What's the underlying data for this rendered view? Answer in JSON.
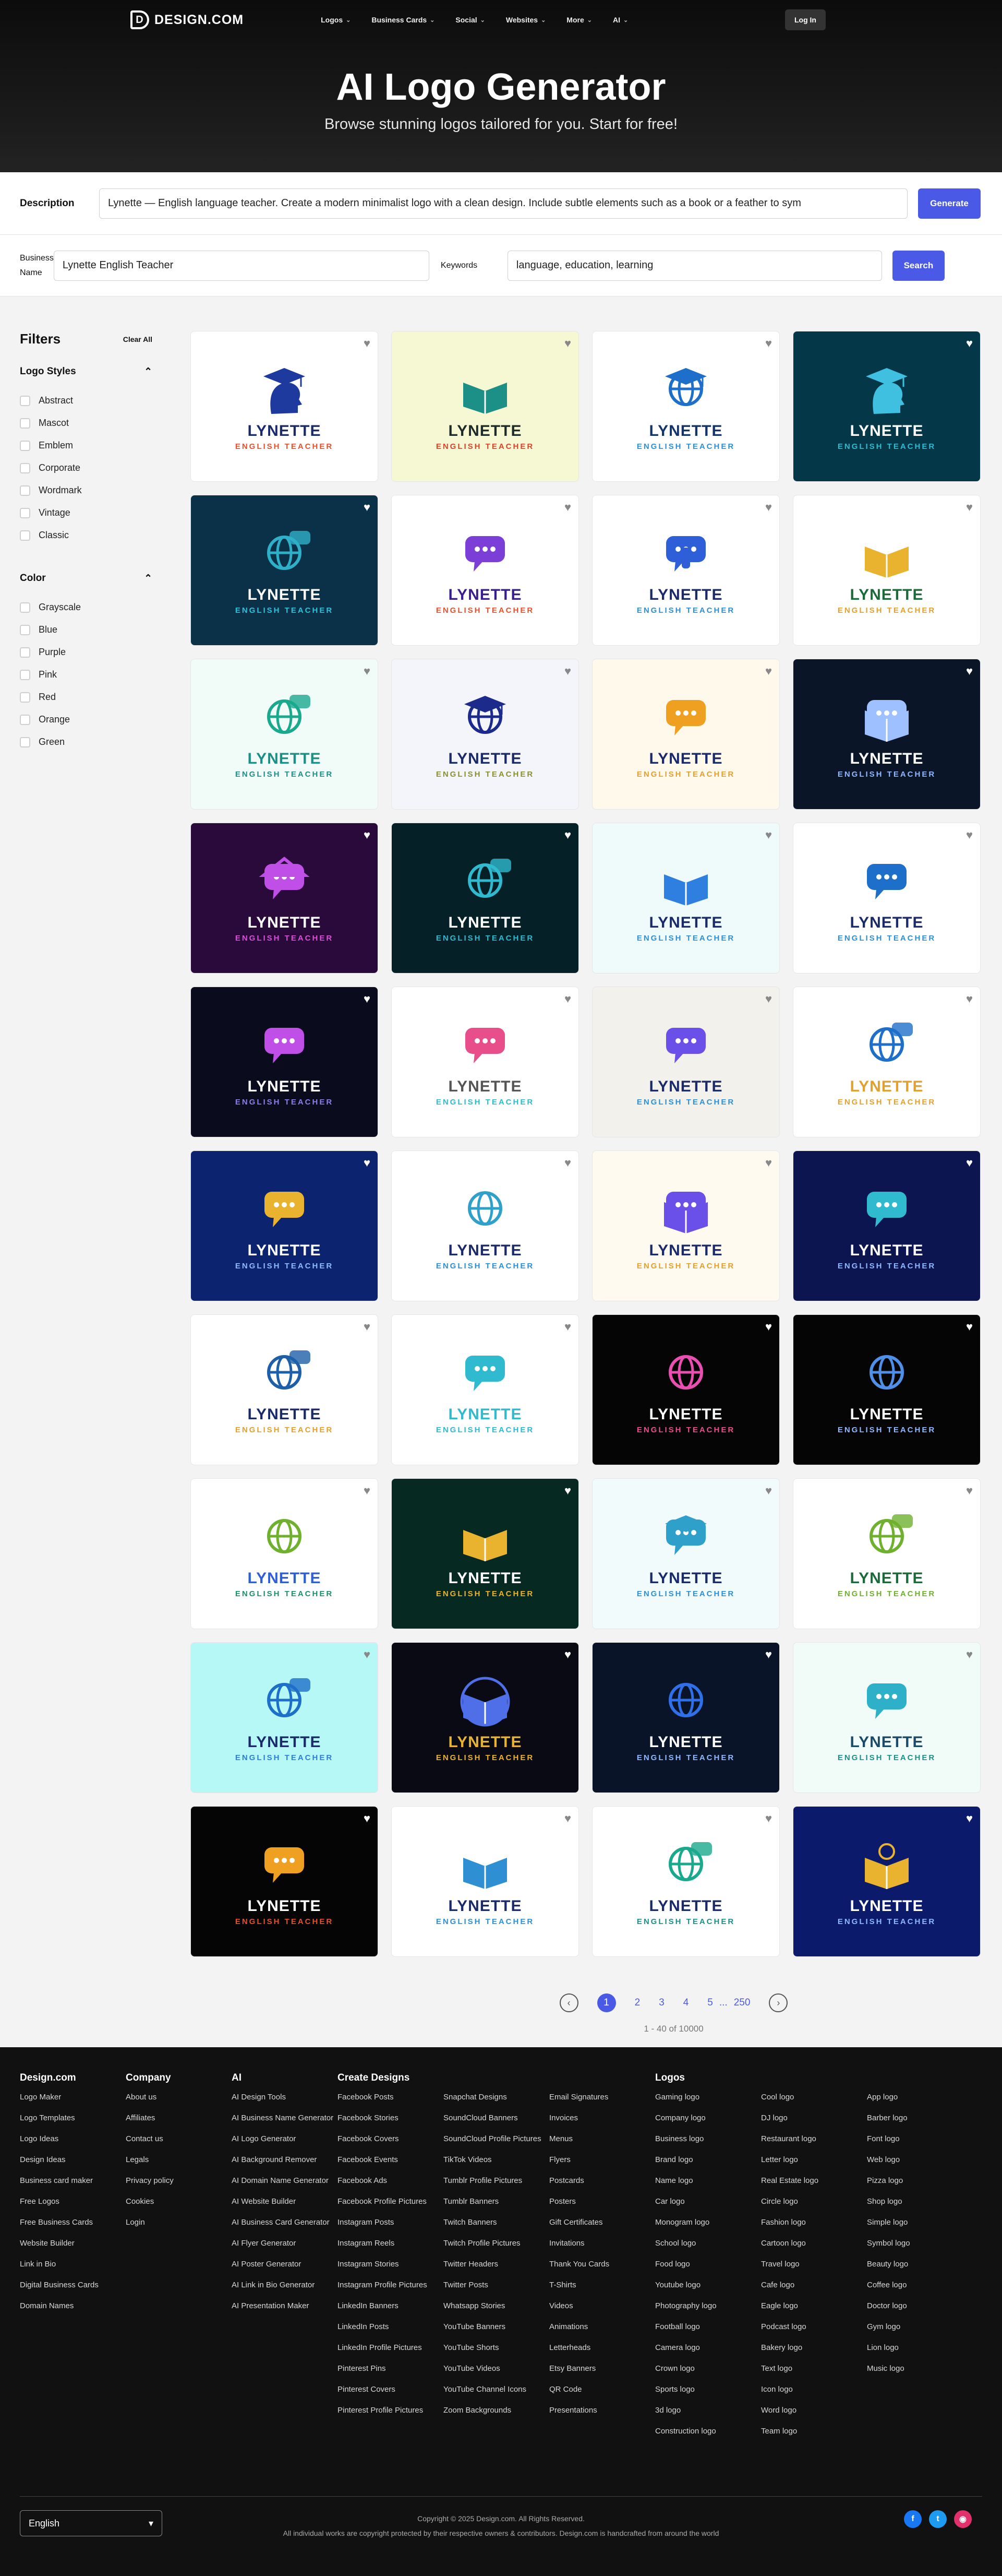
{
  "nav": {
    "brand": "DESIGN.COM",
    "items": [
      "Logos",
      "Business Cards",
      "Social",
      "Websites",
      "More",
      "AI"
    ],
    "login": "Log In"
  },
  "hero": {
    "title": "AI Logo Generator",
    "subtitle": "Browse stunning logos tailored for you. Start for free!"
  },
  "search": {
    "description_label": "Description",
    "description_value": "Lynette — English language teacher. Create a modern minimalist logo with a clean design. Include subtle elements such as a book or a feather to sym",
    "generate": "Generate",
    "business_label_1": "Business",
    "business_label_2": "Name",
    "business_value": "Lynette English Teacher",
    "keywords_label": "Keywords",
    "keywords_value": "language, education, learning",
    "search_btn": "Search"
  },
  "filters": {
    "title": "Filters",
    "clear": "Clear All",
    "styles_title": "Logo Styles",
    "styles": [
      "Abstract",
      "Mascot",
      "Emblem",
      "Corporate",
      "Wordmark",
      "Vintage",
      "Classic"
    ],
    "color_title": "Color",
    "colors": [
      "Grayscale",
      "Blue",
      "Purple",
      "Pink",
      "Red",
      "Orange",
      "Green"
    ]
  },
  "cards": [
    {
      "name": "LYNETTE",
      "sub": "ENGLISH TEACHER",
      "bg": "#ffffff",
      "nc": "#1b2a6b",
      "sc": "#e2522f",
      "icon": "grad-cap-head-icon",
      "ic": "#1e3a9e"
    },
    {
      "name": "LYNETTE",
      "sub": "ENGLISH TEACHER",
      "bg": "#f6f7d3",
      "nc": "#1d2b2b",
      "sc": "#d9442b",
      "icon": "book-speech-icon",
      "ic": "#1c8f86"
    },
    {
      "name": "LYNETTE",
      "sub": "ENGLISH TEACHER",
      "bg": "#ffffff",
      "nc": "#13336b",
      "sc": "#2f8fd3",
      "icon": "globe-cap-icon",
      "ic": "#1e6fc9"
    },
    {
      "name": "LYNETTE",
      "sub": "ENGLISH TEACHER",
      "bg": "#043848",
      "nc": "#ffffff",
      "sc": "#2fbad0",
      "icon": "head-cap-icon",
      "ic": "#3fc0e0"
    },
    {
      "name": "LYNETTE",
      "sub": "ENGLISH TEACHER",
      "bg": "#0b3148",
      "nc": "#ffffff",
      "sc": "#2fc0d8",
      "icon": "globe-chat-icon",
      "ic": "#2fb0c9"
    },
    {
      "name": "LYNETTE",
      "sub": "ENGLISH TEACHER",
      "bg": "#ffffff",
      "nc": "#3a1d8f",
      "sc": "#e2522f",
      "icon": "chat-bubble-icon",
      "ic": "#7b3fd8"
    },
    {
      "name": "LYNETTE",
      "sub": "ENGLISH TEACHER",
      "bg": "#ffffff",
      "nc": "#1b2a6b",
      "sc": "#2f8fd3",
      "icon": "person-chat-icon",
      "ic": "#2f5fd8"
    },
    {
      "name": "LYNETTE",
      "sub": "ENGLISH TEACHER",
      "bg": "#ffffff",
      "nc": "#1b6b3a",
      "sc": "#e2a02f",
      "icon": "open-book-icon",
      "ic": "#e9b22f"
    },
    {
      "name": "LYNETTE",
      "sub": "ENGLISH TEACHER",
      "bg": "#f1fbf7",
      "nc": "#1c8f86",
      "sc": "#1c8f86",
      "icon": "globe-bubble-icon",
      "ic": "#1aa98d"
    },
    {
      "name": "LYNETTE",
      "sub": "ENGLISH TEACHER",
      "bg": "#f4f5fb",
      "nc": "#1b2a6b",
      "sc": "#8a8f2f",
      "icon": "globe-cap-icon",
      "ic": "#1b2a8b"
    },
    {
      "name": "LYNETTE",
      "sub": "ENGLISH TEACHER",
      "bg": "#fff9ec",
      "nc": "#1b2a6b",
      "sc": "#e2a02f",
      "icon": "abc-bubble-icon",
      "ic": "#f0a020"
    },
    {
      "name": "LYNETTE",
      "sub": "ENGLISH TEACHER",
      "bg": "#0b1528",
      "nc": "#ffffff",
      "sc": "#8fb8ff",
      "icon": "book-chat-icon",
      "ic": "#9fc0ff"
    },
    {
      "name": "LYNETTE",
      "sub": "ENGLISH TEACHER",
      "bg": "#2a0a3a",
      "nc": "#ffffff",
      "sc": "#d94fd8",
      "icon": "house-chat-icon",
      "ic": "#c04fe8"
    },
    {
      "name": "LYNETTE",
      "sub": "ENGLISH TEACHER",
      "bg": "#062028",
      "nc": "#ffffff",
      "sc": "#2fbad0",
      "icon": "globe-chat-icon",
      "ic": "#2fbad0"
    },
    {
      "name": "LYNETTE",
      "sub": "ENGLISH TEACHER",
      "bg": "#effbfb",
      "nc": "#1b2a6b",
      "sc": "#2f8fd3",
      "icon": "book-icon",
      "ic": "#2f7fe0"
    },
    {
      "name": "LYNETTE",
      "sub": "ENGLISH TEACHER",
      "bg": "#ffffff",
      "nc": "#1b2a6b",
      "sc": "#2f8fd3",
      "icon": "chat-bubble-icon",
      "ic": "#1e6fc9"
    },
    {
      "name": "LYNETTE",
      "sub": "ENGLISH TEACHER",
      "bg": "#0b0b1e",
      "nc": "#ffffff",
      "sc": "#8a7fe8",
      "icon": "chat-bubble-icon",
      "ic": "#c04fe8"
    },
    {
      "name": "LYNETTE",
      "sub": "ENGLISH TEACHER",
      "bg": "#ffffff",
      "nc": "#555555",
      "sc": "#2fbad0",
      "icon": "chat-bubble-icon",
      "ic": "#e84f8a"
    },
    {
      "name": "LYNETTE",
      "sub": "ENGLISH TEACHER",
      "bg": "#f3f1ec",
      "nc": "#1b2a6b",
      "sc": "#2f8fd3",
      "icon": "chat-bubble-icon",
      "ic": "#6a4fe8"
    },
    {
      "name": "LYNETTE",
      "sub": "ENGLISH TEACHER",
      "bg": "#ffffff",
      "nc": "#e2a02f",
      "sc": "#e2a02f",
      "icon": "globe-bubble-icon",
      "ic": "#1e6fc9"
    },
    {
      "name": "LYNETTE",
      "sub": "ENGLISH TEACHER",
      "bg": "#0c2470",
      "nc": "#ffffff",
      "sc": "#8fb8ff",
      "icon": "chat-bubble-icon",
      "ic": "#e9b22f"
    },
    {
      "name": "LYNETTE",
      "sub": "ENGLISH TEACHER",
      "bg": "#ffffff",
      "nc": "#1b2a6b",
      "sc": "#2f8fd3",
      "icon": "globe-icon",
      "ic": "#2fa0c9"
    },
    {
      "name": "LYNETTE",
      "sub": "ENGLISH TEACHER",
      "bg": "#fffaf0",
      "nc": "#1b2a6b",
      "sc": "#e2a02f",
      "icon": "book-chat-icon",
      "ic": "#6a4fe8"
    },
    {
      "name": "LYNETTE",
      "sub": "ENGLISH TEACHER",
      "bg": "#0c1550",
      "nc": "#ffffff",
      "sc": "#8fb8ff",
      "icon": "chat-bubble-icon",
      "ic": "#2fbad0"
    },
    {
      "name": "LYNETTE",
      "sub": "ENGLISH TEACHER",
      "bg": "#ffffff",
      "nc": "#1b2a6b",
      "sc": "#e2a02f",
      "icon": "globe-chat-icon",
      "ic": "#1e5fa9"
    },
    {
      "name": "LYNETTE",
      "sub": "ENGLISH TEACHER",
      "bg": "#ffffff",
      "nc": "#2fbad0",
      "sc": "#2fbad0",
      "icon": "chat-bubble-icon",
      "ic": "#2fbad0"
    },
    {
      "name": "LYNETTE",
      "sub": "ENGLISH TEACHER",
      "bg": "#050505",
      "nc": "#ffffff",
      "sc": "#e84f8a",
      "icon": "globe-icon",
      "ic": "#e84fb0"
    },
    {
      "name": "LYNETTE",
      "sub": "ENGLISH TEACHER",
      "bg": "#050505",
      "nc": "#ffffff",
      "sc": "#8fb8ff",
      "icon": "globe-icon",
      "ic": "#4f8fe8"
    },
    {
      "name": "LYNETTE",
      "sub": "ENGLISH TEACHER",
      "bg": "#ffffff",
      "nc": "#2f5fd8",
      "sc": "#1c8f6a",
      "icon": "globe-icon",
      "ic": "#6fb02f"
    },
    {
      "name": "LYNETTE",
      "sub": "ENGLISH TEACHER",
      "bg": "#062a22",
      "nc": "#ffffff",
      "sc": "#e9b22f",
      "icon": "book-icon",
      "ic": "#e9b22f"
    },
    {
      "name": "LYNETTE",
      "sub": "ENGLISH TEACHER",
      "bg": "#f1fbfb",
      "nc": "#1b2a6b",
      "sc": "#2f8fd3",
      "icon": "grad-cap-chat-icon",
      "ic": "#2fa0c9"
    },
    {
      "name": "LYNETTE",
      "sub": "ENGLISH TEACHER",
      "bg": "#ffffff",
      "nc": "#1b6b3a",
      "sc": "#6fb02f",
      "icon": "globe-chat-icon",
      "ic": "#6fb02f"
    },
    {
      "name": "LYNETTE",
      "sub": "ENGLISH TEACHER",
      "bg": "#b5f8f5",
      "nc": "#1b2a6b",
      "sc": "#2f7fd3",
      "icon": "globe-bubble-icon",
      "ic": "#1e6fc9"
    },
    {
      "name": "LYNETTE",
      "sub": "ENGLISH TEACHER",
      "bg": "#0a0a14",
      "nc": "#e9b22f",
      "sc": "#e9b22f",
      "icon": "badge-book-icon",
      "ic": "#4f6fe8"
    },
    {
      "name": "LYNETTE",
      "sub": "ENGLISH TEACHER",
      "bg": "#0a1428",
      "nc": "#ffffff",
      "sc": "#8fb8ff",
      "icon": "globe-icon",
      "ic": "#2f6fe8"
    },
    {
      "name": "LYNETTE",
      "sub": "ENGLISH TEACHER",
      "bg": "#f1fbf7",
      "nc": "#1b4a6b",
      "sc": "#1c8f86",
      "icon": "chat-bubble-icon",
      "ic": "#2fb0c9"
    },
    {
      "name": "LYNETTE",
      "sub": "ENGLISH TEACHER",
      "bg": "#050505",
      "nc": "#ffffff",
      "sc": "#e2522f",
      "icon": "chat-bubble-icon",
      "ic": "#f0a020"
    },
    {
      "name": "LYNETTE",
      "sub": "ENGLISH TEACHER",
      "bg": "#ffffff",
      "nc": "#1b2a6b",
      "sc": "#2f8fd3",
      "icon": "book-icon",
      "ic": "#2f8fd3"
    },
    {
      "name": "LYNETTE",
      "sub": "ENGLISH TEACHER",
      "bg": "#ffffff",
      "nc": "#1b2a6b",
      "sc": "#1c8f86",
      "icon": "globe-chat-icon",
      "ic": "#1aa98d"
    },
    {
      "name": "LYNETTE",
      "sub": "ENGLISH TEACHER",
      "bg": "#0c1a6b",
      "nc": "#ffffff",
      "sc": "#8fb8ff",
      "icon": "book-clock-icon",
      "ic": "#e9b22f"
    }
  ],
  "pagination": {
    "pages": [
      "1",
      "2",
      "3",
      "4",
      "5",
      "...",
      "250"
    ],
    "count": "1 - 40 of 10000"
  },
  "footer": {
    "columns": [
      {
        "title": "Design.com",
        "links": [
          "Logo Maker",
          "Logo Templates",
          "Logo Ideas",
          "Design Ideas",
          "Business card maker",
          "Free Logos",
          "Free Business Cards",
          "Website Builder",
          "Link in Bio",
          "Digital Business Cards",
          "Domain Names"
        ]
      },
      {
        "title": "Company",
        "links": [
          "About us",
          "Affiliates",
          "Contact us",
          "Legals",
          "Privacy policy",
          "Cookies",
          "Login"
        ]
      },
      {
        "title": "AI",
        "links": [
          "AI Design Tools",
          "AI Business Name Generator",
          "AI Logo Generator",
          "AI Background Remover",
          "AI Domain Name Generator",
          "AI Website Builder",
          "AI Business Card Generator",
          "AI Flyer Generator",
          "AI Poster Generator",
          "AI Link in Bio Generator",
          "AI Presentation Maker"
        ]
      },
      {
        "title": "Create Designs",
        "links": [
          "Facebook Posts",
          "Facebook Stories",
          "Facebook Covers",
          "Facebook Events",
          "Facebook Ads",
          "Facebook Profile Pictures",
          "Instagram Posts",
          "Instagram Reels",
          "Instagram Stories",
          "Instagram Profile Pictures",
          "LinkedIn Banners",
          "LinkedIn Posts",
          "LinkedIn Profile Pictures",
          "Pinterest Pins",
          "Pinterest Covers",
          "Pinterest Profile Pictures"
        ]
      },
      {
        "title": "",
        "links": [
          "Snapchat Designs",
          "SoundCloud Banners",
          "SoundCloud Profile Pictures",
          "TikTok Videos",
          "Tumblr Profile Pictures",
          "Tumblr Banners",
          "Twitch Banners",
          "Twitch Profile Pictures",
          "Twitter Headers",
          "Twitter Posts",
          "Whatsapp Stories",
          "YouTube Banners",
          "YouTube Shorts",
          "YouTube Videos",
          "YouTube Channel Icons",
          "Zoom Backgrounds"
        ]
      },
      {
        "title": "",
        "links": [
          "Email Signatures",
          "Invoices",
          "Menus",
          "Flyers",
          "Postcards",
          "Posters",
          "Gift Certificates",
          "Invitations",
          "Thank You Cards",
          "T-Shirts",
          "Videos",
          "Animations",
          "Letterheads",
          "Etsy Banners",
          "QR Code",
          "Presentations"
        ]
      },
      {
        "title": "Logos",
        "links": [
          "Gaming logo",
          "Company logo",
          "Business logo",
          "Brand logo",
          "Name logo",
          "Car logo",
          "Monogram logo",
          "School logo",
          "Food logo",
          "Youtube logo",
          "Photography logo",
          "Football logo",
          "Camera logo",
          "Crown logo",
          "Sports logo",
          "3d logo",
          "Construction logo"
        ]
      },
      {
        "title": "",
        "links": [
          "Cool logo",
          "DJ logo",
          "Restaurant logo",
          "Letter logo",
          "Real Estate logo",
          "Circle logo",
          "Fashion logo",
          "Cartoon logo",
          "Travel logo",
          "Cafe logo",
          "Eagle logo",
          "Podcast logo",
          "Bakery logo",
          "Text logo",
          "Icon logo",
          "Word logo",
          "Team logo"
        ]
      },
      {
        "title": "",
        "links": [
          "App logo",
          "Barber logo",
          "Font logo",
          "Web logo",
          "Pizza logo",
          "Shop logo",
          "Simple logo",
          "Symbol logo",
          "Beauty logo",
          "Coffee logo",
          "Doctor logo",
          "Gym logo",
          "Lion logo",
          "Music logo"
        ]
      }
    ],
    "language": "English",
    "copyright": "Copyright © 2025 Design.com. All Rights Reserved.",
    "notice": "All individual works are copyright protected by their respective owners & contributors. Design.com is handcrafted from around the world"
  }
}
